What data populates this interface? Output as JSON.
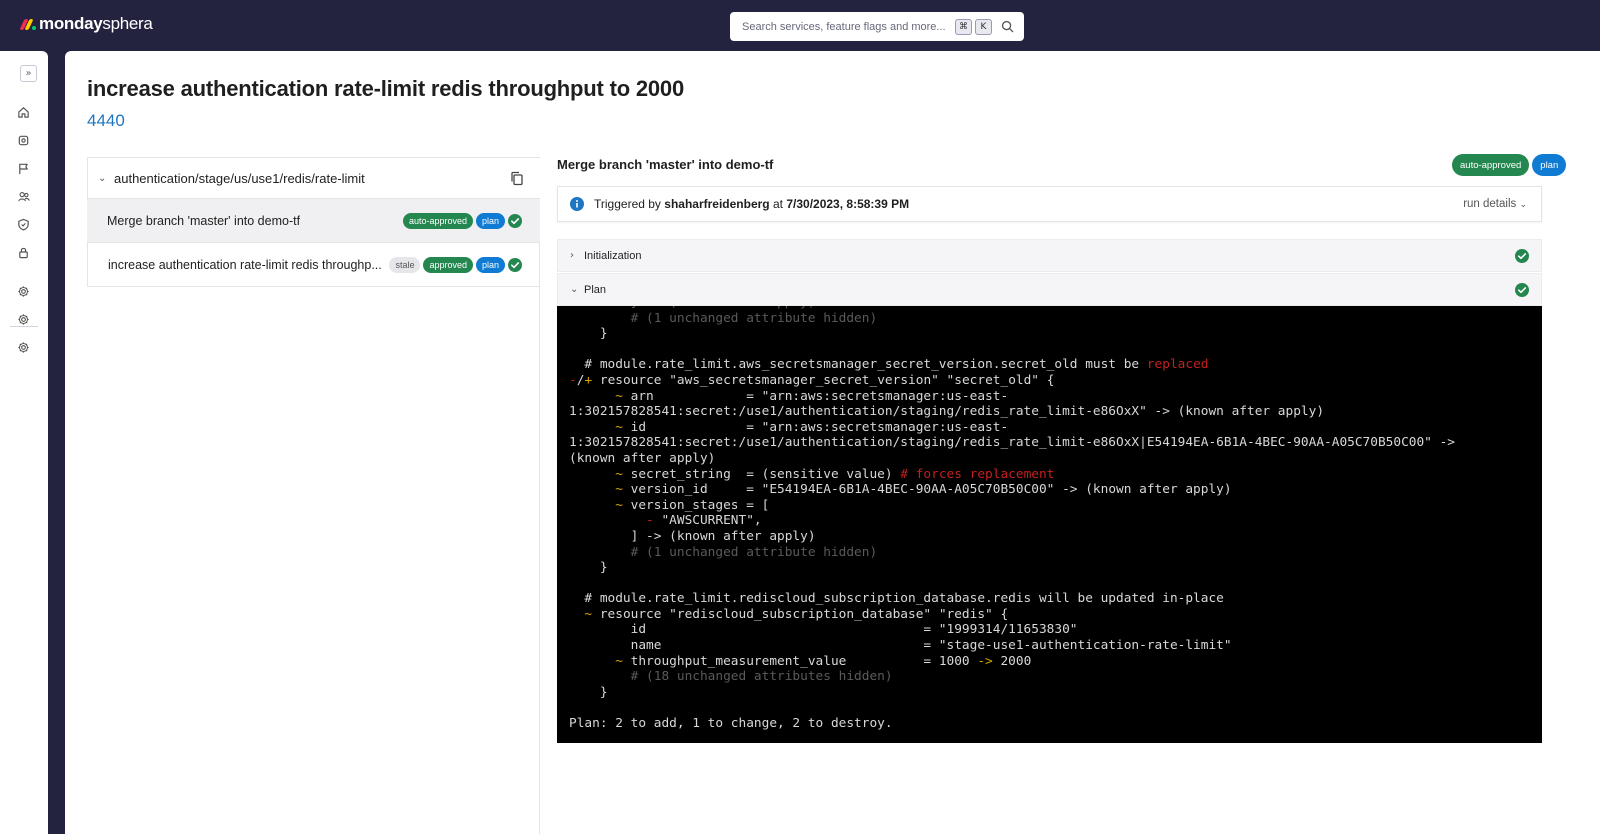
{
  "app": {
    "brand_bold": "monday",
    "brand_light": "sphera"
  },
  "search": {
    "placeholder": "Search services, feature flags and more...",
    "key1": "⌘",
    "key2": "K"
  },
  "rail": {
    "expand": "»"
  },
  "page": {
    "title": "increase authentication rate-limit redis throughput to 2000",
    "id": "4440"
  },
  "runs": {
    "path": "authentication/stage/us/use1/redis/rate-limit",
    "items": [
      {
        "label": "Merge branch 'master' into demo-tf",
        "tags": [
          "auto-approved",
          "plan"
        ],
        "status": "success"
      },
      {
        "label": "increase authentication rate-limit redis throughp...",
        "tags": [
          "stale",
          "approved",
          "plan"
        ],
        "status": "success"
      }
    ]
  },
  "detail": {
    "commit_title": "Merge branch 'master' into demo-tf",
    "tags": [
      "auto-approved",
      "plan"
    ],
    "trigger_prefix": "Triggered by",
    "trigger_user": "shaharfreidenberg",
    "trigger_at": "at",
    "trigger_time": "7/30/2023, 8:58:39 PM",
    "run_details": "run details",
    "steps": [
      {
        "label": "Initialization",
        "status": "success",
        "expanded": false
      },
      {
        "label": "Plan",
        "status": "success",
        "expanded": true
      }
    ]
  },
  "terminal": {
    "lines": [
      {
        "segs": [
          [
            "dim",
            "        } -> (known after apply)"
          ]
        ]
      },
      {
        "segs": [
          [
            "dim",
            "        # (1 unchanged attribute hidden)"
          ]
        ]
      },
      {
        "segs": [
          [
            "txt",
            "    }"
          ]
        ]
      },
      {
        "segs": [
          [
            "txt",
            ""
          ]
        ]
      },
      {
        "segs": [
          [
            "txt",
            "  # module.rate_limit.aws_secretsmanager_secret_version.secret_old must be "
          ],
          [
            "red",
            "replaced"
          ]
        ]
      },
      {
        "segs": [
          [
            "red",
            "-"
          ],
          [
            "txt",
            "/"
          ],
          [
            "yel",
            "+"
          ],
          [
            "txt",
            " resource \"aws_secretsmanager_secret_version\" \"secret_old\" {"
          ]
        ]
      },
      {
        "segs": [
          [
            "yel",
            "      ~"
          ],
          [
            "txt",
            " arn            = \"arn:aws:secretsmanager:us-east-"
          ]
        ]
      },
      {
        "segs": [
          [
            "txt",
            "1:302157828541:secret:/use1/authentication/staging/redis_rate_limit-e86OxX\" -> (known after apply)"
          ]
        ]
      },
      {
        "segs": [
          [
            "yel",
            "      ~"
          ],
          [
            "txt",
            " id             = \"arn:aws:secretsmanager:us-east-"
          ]
        ]
      },
      {
        "segs": [
          [
            "txt",
            "1:302157828541:secret:/use1/authentication/staging/redis_rate_limit-e86OxX|E54194EA-6B1A-4BEC-90AA-A05C70B50C00\" ->"
          ]
        ]
      },
      {
        "segs": [
          [
            "txt",
            "(known after apply)"
          ]
        ]
      },
      {
        "segs": [
          [
            "yel",
            "      ~"
          ],
          [
            "txt",
            " secret_string  = (sensitive value) "
          ],
          [
            "red",
            "# forces replacement"
          ]
        ]
      },
      {
        "segs": [
          [
            "yel",
            "      ~"
          ],
          [
            "txt",
            " version_id     = \"E54194EA-6B1A-4BEC-90AA-A05C70B50C00\" -> (known after apply)"
          ]
        ]
      },
      {
        "segs": [
          [
            "yel",
            "      ~"
          ],
          [
            "txt",
            " version_stages = ["
          ]
        ]
      },
      {
        "segs": [
          [
            "red",
            "          -"
          ],
          [
            "txt",
            " \"AWSCURRENT\","
          ]
        ]
      },
      {
        "segs": [
          [
            "txt",
            "        ] -> (known after apply)"
          ]
        ]
      },
      {
        "segs": [
          [
            "dim",
            "        # (1 unchanged attribute hidden)"
          ]
        ]
      },
      {
        "segs": [
          [
            "txt",
            "    }"
          ]
        ]
      },
      {
        "segs": [
          [
            "txt",
            ""
          ]
        ]
      },
      {
        "segs": [
          [
            "txt",
            "  # module.rate_limit.rediscloud_subscription_database.redis will be updated in-place"
          ]
        ]
      },
      {
        "segs": [
          [
            "yel",
            "  ~"
          ],
          [
            "txt",
            " resource \"rediscloud_subscription_database\" \"redis\" {"
          ]
        ]
      },
      {
        "segs": [
          [
            "txt",
            "        id                                    = \"1999314/11653830\""
          ]
        ]
      },
      {
        "segs": [
          [
            "txt",
            "        name                                  = \"stage-use1-authentication-rate-limit\""
          ]
        ]
      },
      {
        "segs": [
          [
            "yel",
            "      ~"
          ],
          [
            "txt",
            " throughput_measurement_value          = 1000 "
          ],
          [
            "yel",
            "->"
          ],
          [
            "txt",
            " 2000"
          ]
        ]
      },
      {
        "segs": [
          [
            "dim",
            "        # (18 unchanged attributes hidden)"
          ]
        ]
      },
      {
        "segs": [
          [
            "txt",
            "    }"
          ]
        ]
      },
      {
        "segs": [
          [
            "txt",
            ""
          ]
        ]
      },
      {
        "segs": [
          [
            "txt",
            "Plan: 2 to add, 1 to change, 2 to destroy."
          ]
        ]
      }
    ]
  },
  "colors": {
    "topbar": "#23233f",
    "approved_green": "#258750",
    "plan_blue": "#0f7bd3",
    "link_blue": "#1f76c2",
    "success_green": "#258750"
  },
  "icons": [
    "home-icon",
    "gear-icon",
    "flag-icon",
    "users-icon",
    "shield-icon",
    "lock-icon",
    "copy-icon",
    "info-icon",
    "check-circle-icon",
    "search-icon"
  ]
}
